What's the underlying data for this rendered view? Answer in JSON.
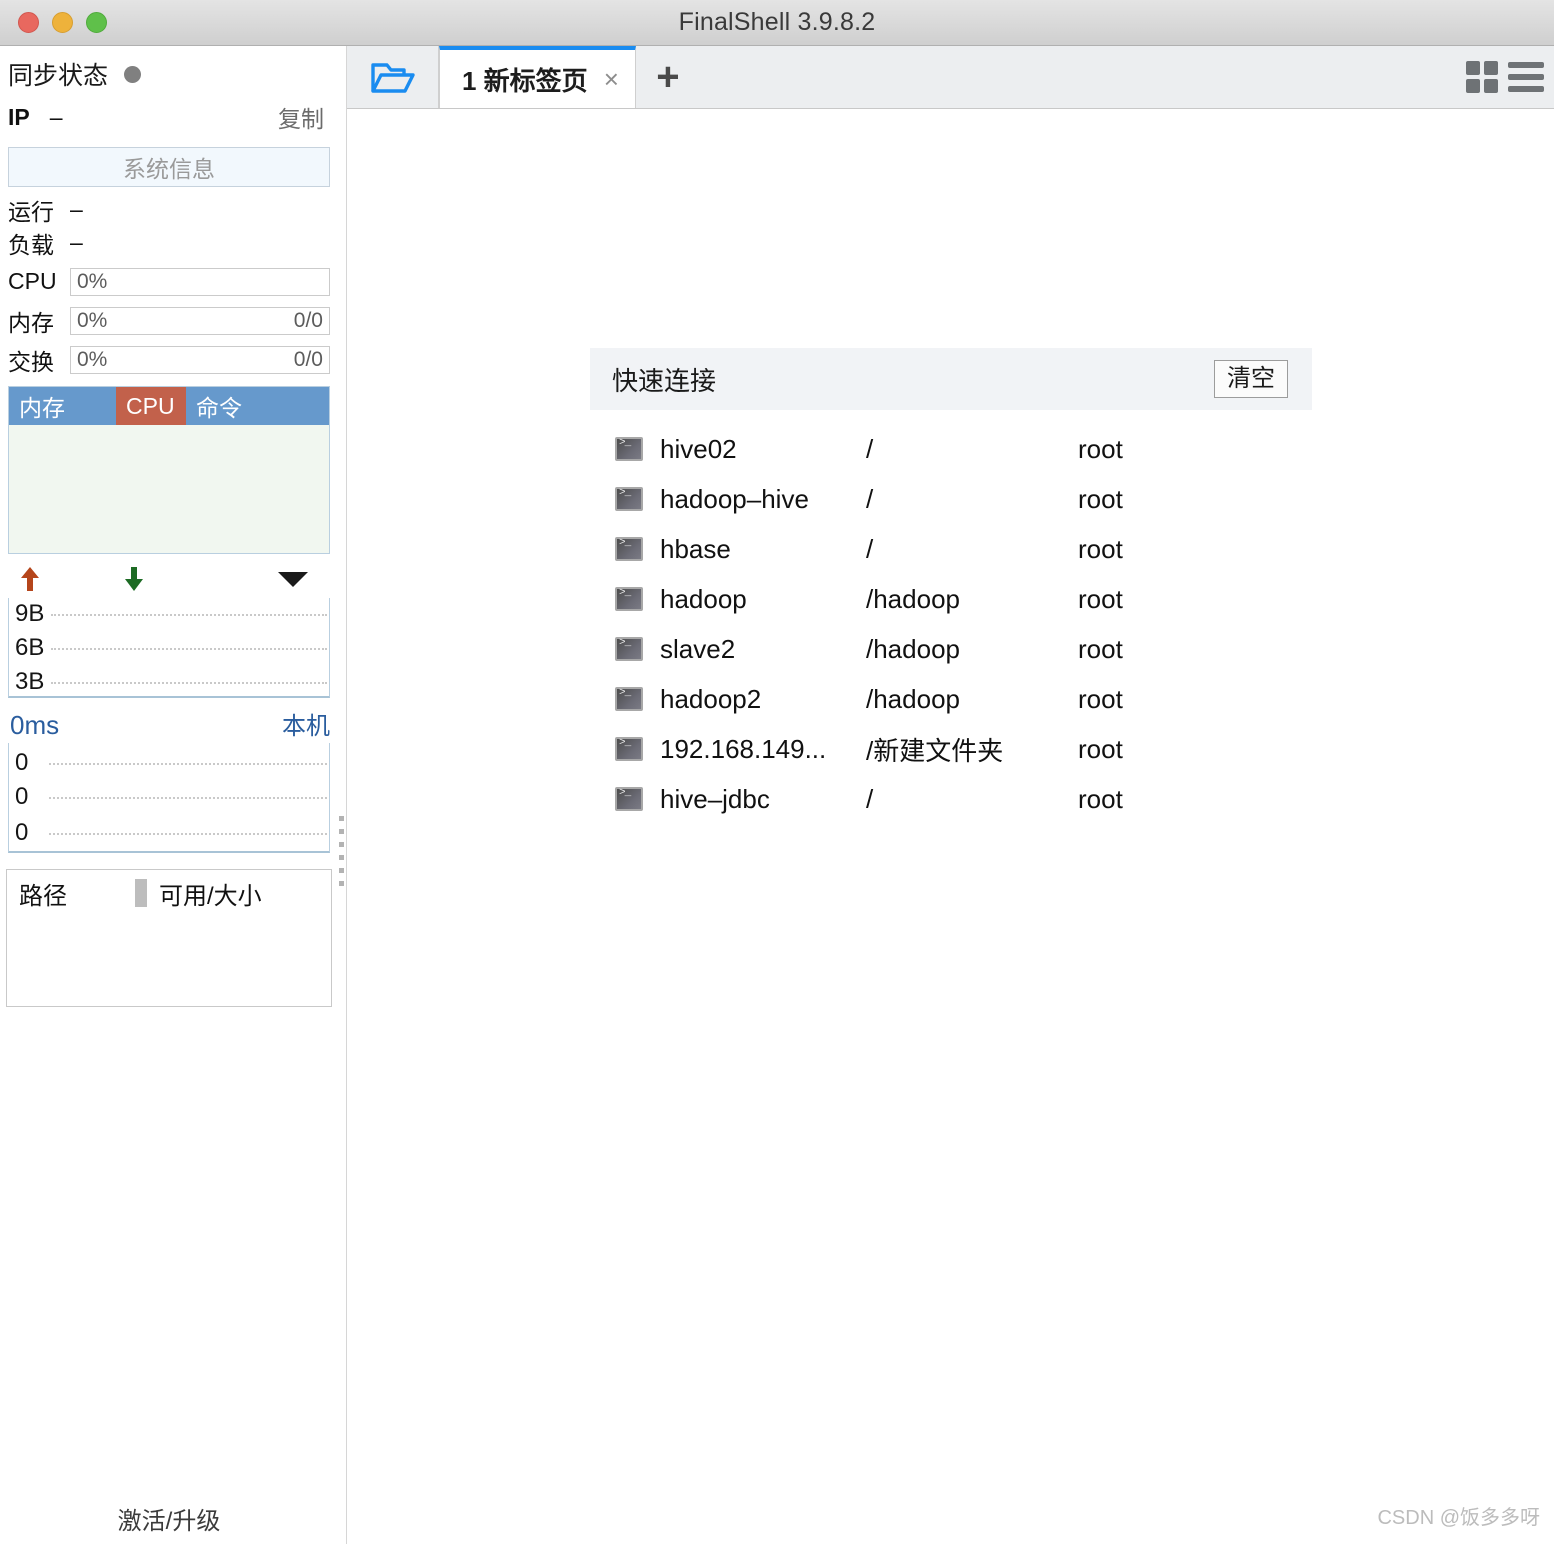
{
  "window": {
    "title": "FinalShell 3.9.8.2",
    "controls": [
      "close",
      "minimize",
      "maximize"
    ]
  },
  "sidebar": {
    "sync_status_label": "同步状态",
    "sync_status_state": "idle",
    "ip_label": "IP",
    "ip_value": "–",
    "copy_label": "复制",
    "system_info_button": "系统信息",
    "metrics": [
      {
        "key": "运行",
        "value": "–",
        "type": "plain"
      },
      {
        "key": "负载",
        "value": "–",
        "type": "plain"
      },
      {
        "key": "CPU",
        "value": "0%",
        "right": "",
        "type": "box"
      },
      {
        "key": "内存",
        "value": "0%",
        "right": "0/0",
        "type": "box"
      },
      {
        "key": "交换",
        "value": "0%",
        "right": "0/0",
        "type": "box"
      }
    ],
    "process_table": {
      "columns": [
        "内存",
        "CPU",
        "命令"
      ],
      "active_column": "CPU",
      "rows": []
    },
    "network": {
      "upload_icon": "arrow-up-icon",
      "download_icon": "arrow-down-icon",
      "dropdown_icon": "chevron-down-icon",
      "y_labels": [
        "9B",
        "6B",
        "3B"
      ]
    },
    "latency": {
      "value": "0ms",
      "host": "本机",
      "y_labels": [
        "0",
        "0",
        "0"
      ]
    },
    "disk_table": {
      "columns": [
        "路径",
        "可用/大小"
      ],
      "rows": []
    },
    "activate_label": "激活/升级"
  },
  "tabbar": {
    "folder_icon": "open-folder-icon",
    "tabs": [
      {
        "label": "1 新标签页",
        "close": "×",
        "active": true
      }
    ],
    "new_tab_label": "+",
    "grid_view_icon": "grid-view-icon",
    "menu_icon": "hamburger-menu-icon"
  },
  "quick_connect": {
    "title": "快速连接",
    "clear_label": "清空",
    "columns": [
      "name",
      "path",
      "user"
    ],
    "items": [
      {
        "icon": "terminal-icon",
        "name": "hive02",
        "path": "/",
        "user": "root"
      },
      {
        "icon": "terminal-icon",
        "name": "hadoop–hive",
        "path": "/",
        "user": "root"
      },
      {
        "icon": "terminal-icon",
        "name": "hbase",
        "path": "/",
        "user": "root"
      },
      {
        "icon": "terminal-icon",
        "name": "hadoop",
        "path": "/hadoop",
        "user": "root"
      },
      {
        "icon": "terminal-icon",
        "name": "slave2",
        "path": "/hadoop",
        "user": "root"
      },
      {
        "icon": "terminal-icon",
        "name": "hadoop2",
        "path": "/hadoop",
        "user": "root"
      },
      {
        "icon": "terminal-icon",
        "name": "192.168.149...",
        "path": "/新建文件夹",
        "user": "root"
      },
      {
        "icon": "terminal-icon",
        "name": "hive–jdbc",
        "path": "/",
        "user": "root"
      }
    ]
  },
  "watermark": "CSDN @饭多多呀",
  "colors": {
    "accent_blue": "#1a8cf0",
    "table_header_blue": "#6699cc",
    "table_header_red": "#c2614b",
    "link_blue": "#2a5d9e",
    "upload_arrow": "#b5451b",
    "download_arrow": "#1d6b24"
  }
}
